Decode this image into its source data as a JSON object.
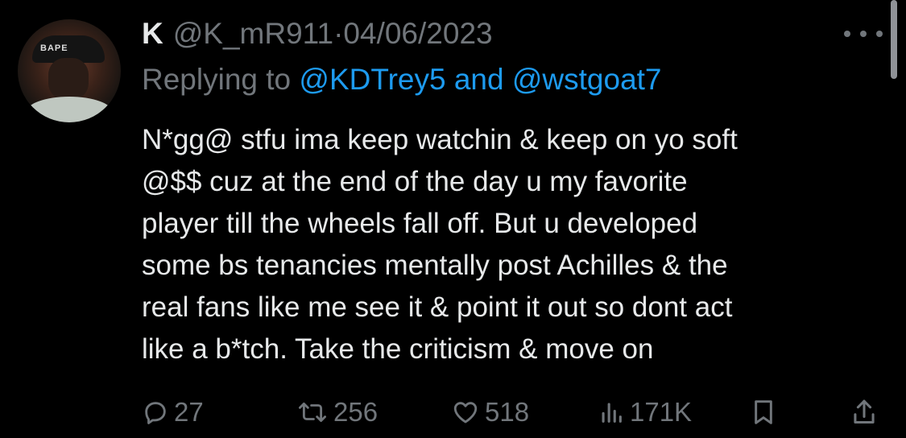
{
  "tweet": {
    "display_name": "K",
    "handle": "@K_mR911",
    "separator": "·",
    "date": "04/06/2023",
    "replying_prefix": "Replying to",
    "reply_user_1": "@KDTrey5",
    "reply_and": "and",
    "reply_user_2": "@wstgoat7",
    "body_lines": [
      "N*gg@ stfu ima keep watchin & keep on yo soft",
      "@$$ cuz at the end of the day u my favorite",
      "player till the wheels fall off. But u developed",
      "some bs tenancies mentally post Achilles & the",
      "real fans like me see it & point it out so dont act",
      "like a b*tch. Take the criticism & move on"
    ],
    "avatar_cap_text": "BAPE"
  },
  "actions": {
    "replies": "27",
    "retweets": "256",
    "likes": "518",
    "views": "171K"
  },
  "icons": {
    "reply": "reply-icon",
    "retweet": "retweet-icon",
    "like": "heart-icon",
    "views": "views-icon",
    "bookmark": "bookmark-icon",
    "share": "share-icon",
    "more": "more-icon"
  },
  "colors": {
    "background": "#000000",
    "text": "#e7e9ea",
    "muted": "#71767b",
    "link": "#1d9bf0"
  }
}
